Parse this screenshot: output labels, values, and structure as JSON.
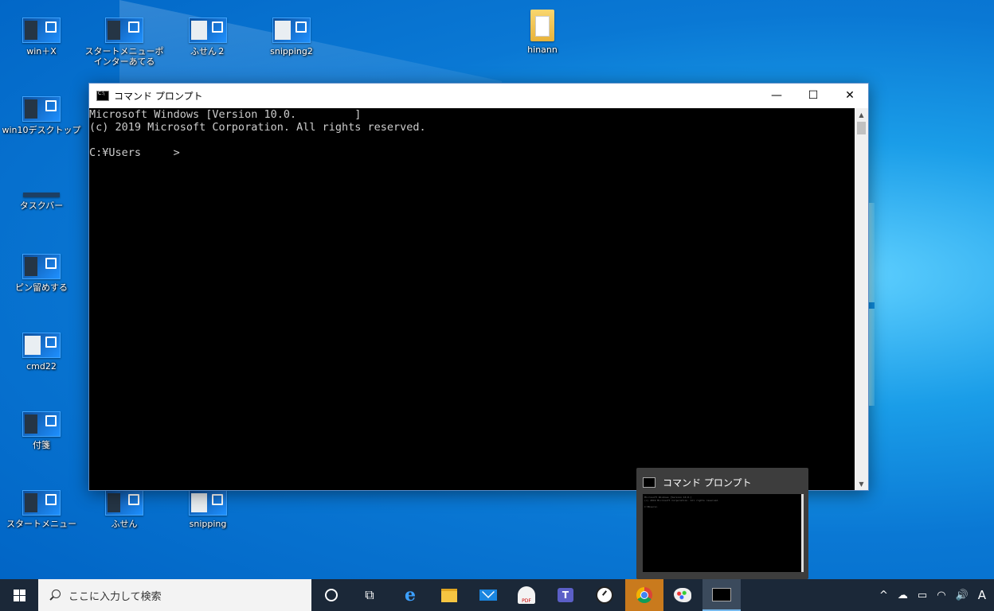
{
  "desktop": {
    "icons": [
      {
        "label": "win＋X"
      },
      {
        "label": "スタートメニューポインターあてる"
      },
      {
        "label": "ふせん２"
      },
      {
        "label": "snipping2"
      },
      {
        "label": "hinann"
      },
      {
        "label": "win10デスクトップ"
      },
      {
        "label": "タスクバー"
      },
      {
        "label": "ピン留めする"
      },
      {
        "label": "cmd22"
      },
      {
        "label": "付箋"
      },
      {
        "label": "スタートメニュー"
      },
      {
        "label": "ふせん"
      },
      {
        "label": "snipping"
      }
    ]
  },
  "cmd_window": {
    "title": "コマンド プロンプト",
    "buttons": {
      "minimize": "—",
      "maximize": "☐",
      "close": "✕"
    },
    "console_text": "Microsoft Windows [Version 10.0.         ]\n(c) 2019 Microsoft Corporation. All rights reserved.\n\nC:¥Users     >"
  },
  "preview": {
    "title": "コマンド プロンプト",
    "mini_text": "Microsoft Windows [Version 10.0.]\n(c) 2019 Microsoft Corporation. All rights reserved.\n\nC:¥Users>"
  },
  "taskbar": {
    "search_placeholder": "ここに入力して検索",
    "pdf_label": "PDF",
    "teams_label": "T",
    "ime_label": "A",
    "tray": {
      "chevron": "^",
      "volume": "🔊"
    }
  },
  "colors": {
    "taskbar_bg": "#1b2838",
    "console_bg": "#000000",
    "console_text": "#cccccc",
    "active_accent": "#76b9ed"
  }
}
